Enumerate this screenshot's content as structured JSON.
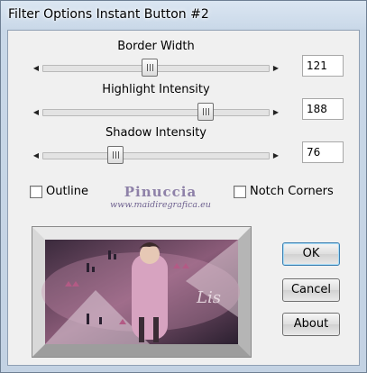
{
  "window": {
    "title": "Filter Options Instant Button #2"
  },
  "sliders": [
    {
      "label": "Border Width",
      "value": "121",
      "level": 0.47
    },
    {
      "label": "Highlight Intensity",
      "value": "188",
      "level": 0.74
    },
    {
      "label": "Shadow Intensity",
      "value": "76",
      "level": 0.3
    }
  ],
  "checkboxes": {
    "outline": {
      "label": "Outline",
      "checked": false
    },
    "notch_corners": {
      "label": "Notch Corners",
      "checked": false
    }
  },
  "watermark": {
    "name": "Pinuccia",
    "url": "www.maidiregrafica.eu"
  },
  "buttons": {
    "ok": "OK",
    "cancel": "Cancel",
    "about": "About"
  },
  "colors": {
    "preview_frame": "#cfcfcf",
    "preview_accent": "#b35a85",
    "preview_dark": "#2a2030"
  }
}
